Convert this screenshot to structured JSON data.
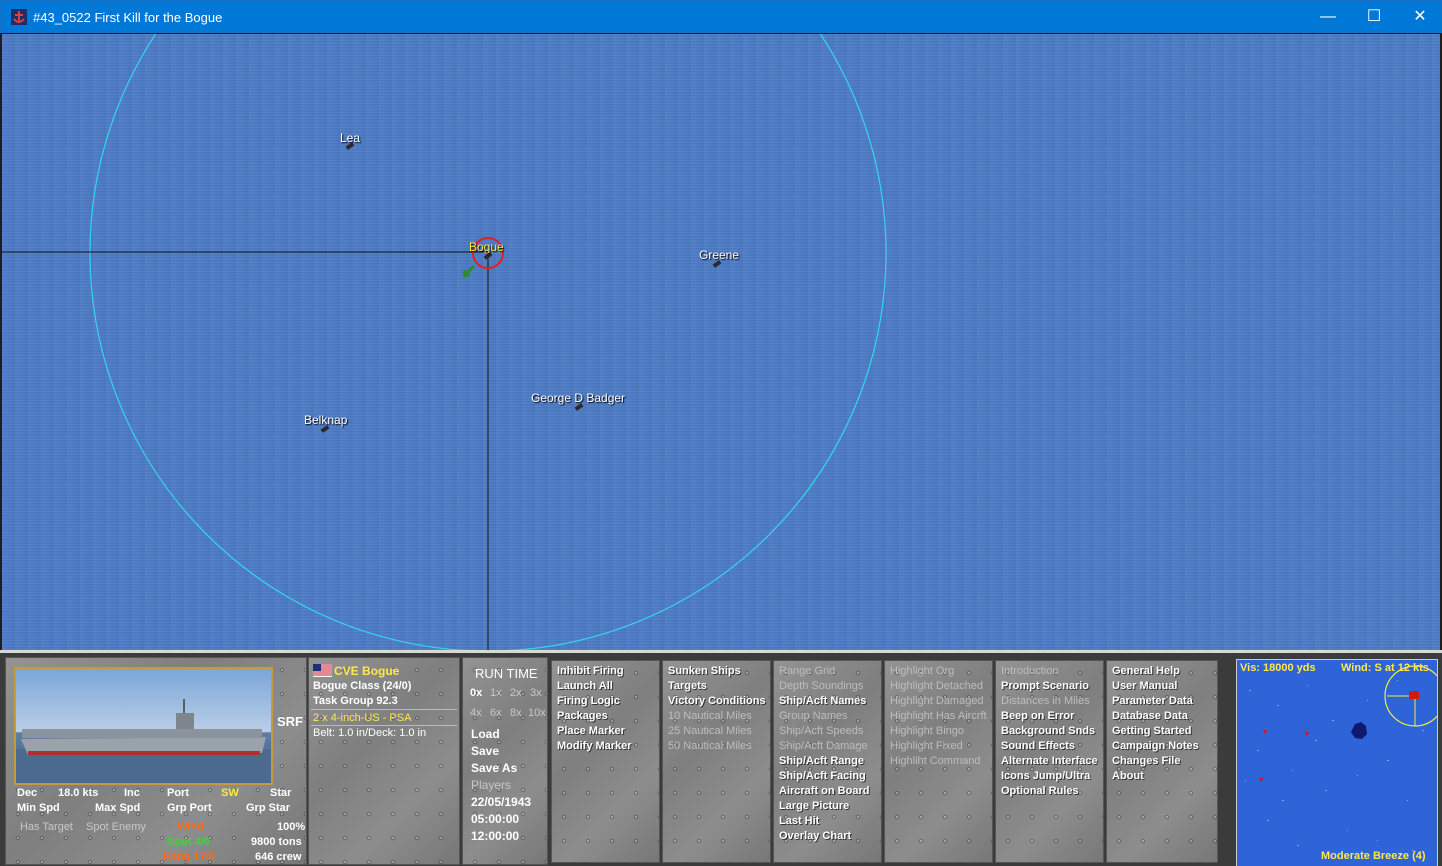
{
  "window": {
    "title": "#43_0522 First Kill for the Bogue",
    "minimize": "—",
    "maximize": "☐",
    "close": "✕"
  },
  "map": {
    "ships": [
      {
        "name": "Lea"
      },
      {
        "name": "Bogue",
        "selected": true
      },
      {
        "name": "Greene"
      },
      {
        "name": "George D Badger"
      },
      {
        "name": "Belknap"
      }
    ],
    "colors": {
      "sea": "#4a79c3",
      "range_circle": "#33d6f0",
      "selection": "#e02020"
    }
  },
  "unit": {
    "name": "CVE Bogue",
    "class": "Bogue Class (24/0)",
    "group": "Task Group 92.3",
    "weapon": "2 x 4-inch-US - PSA",
    "armor": "Belt: 1.0 in/Deck: 1.0 in",
    "srf": "SRF",
    "flag": "us-flag-icon"
  },
  "helm": {
    "dec": "Dec",
    "speed": "18.0 kts",
    "inc": "Inc",
    "port": "Port",
    "dir": "SW",
    "star": "Star",
    "min_spd": "Min Spd",
    "max_spd": "Max Spd",
    "grp_port": "Grp Port",
    "grp_star": "Grp Star"
  },
  "status": {
    "has_target": "Has Target",
    "spot_enemy": "Spot Enemy",
    "wind": "Wind",
    "percent": "100%",
    "spot": "Spot 4/0",
    "tons": "9800 tons",
    "hang": "Hang 17/0",
    "crew": "646 crew"
  },
  "time": {
    "title": "RUN TIME",
    "speeds_row1": [
      "0x",
      "1x",
      "2x",
      "3x"
    ],
    "speeds_row2": [
      "4x",
      "6x",
      "8x",
      "10x"
    ],
    "file": [
      "Load",
      "Save",
      "Save As"
    ],
    "players": "Players",
    "date": "22/05/1943",
    "time1": "05:00:00",
    "time2": "12:00:00"
  },
  "menus": {
    "col1": [
      {
        "label": "Inhibit Firing",
        "enabled": true
      },
      {
        "label": "Launch All",
        "enabled": true
      },
      {
        "label": "Firing Logic",
        "enabled": true
      },
      {
        "label": "Packages",
        "enabled": true
      },
      {
        "label": "Place Marker",
        "enabled": true
      },
      {
        "label": "Modify Marker",
        "enabled": true
      }
    ],
    "col2": [
      {
        "label": "Sunken Ships",
        "enabled": true
      },
      {
        "label": "Targets",
        "enabled": true
      },
      {
        "label": "Victory Conditions",
        "enabled": true
      },
      {
        "label": "10 Nautical Miles",
        "enabled": false
      },
      {
        "label": "25 Nautical Miles",
        "enabled": false
      },
      {
        "label": "50 Nautical Miles",
        "enabled": false
      }
    ],
    "col3": [
      {
        "label": "Range Grid",
        "enabled": false
      },
      {
        "label": "Depth Soundings",
        "enabled": false
      },
      {
        "label": "Ship/Acft Names",
        "enabled": true
      },
      {
        "label": "Group Names",
        "enabled": false
      },
      {
        "label": "Ship/Acft Speeds",
        "enabled": false
      },
      {
        "label": "Ship/Acft Damage",
        "enabled": false
      },
      {
        "label": "Ship/Acft Range",
        "enabled": true
      },
      {
        "label": "Ship/Acft Facing",
        "enabled": true
      },
      {
        "label": "Aircraft on Board",
        "enabled": true
      },
      {
        "label": "Large Picture",
        "enabled": true
      },
      {
        "label": "Last Hit",
        "enabled": true
      },
      {
        "label": "Overlay Chart",
        "enabled": true
      }
    ],
    "col4": [
      {
        "label": "Highlight Org",
        "enabled": false
      },
      {
        "label": "Highlight Detached",
        "enabled": false
      },
      {
        "label": "Highlight Damaged",
        "enabled": false
      },
      {
        "label": "Highlight Has Aircrft",
        "enabled": false
      },
      {
        "label": "Highlight Bingo",
        "enabled": false
      },
      {
        "label": "Highlight Fixed",
        "enabled": false
      },
      {
        "label": "Highliht Command",
        "enabled": false
      }
    ],
    "col5": [
      {
        "label": "Introduction",
        "enabled": false
      },
      {
        "label": "Prompt Scenario",
        "enabled": true
      },
      {
        "label": "Distances in Miles",
        "enabled": false
      },
      {
        "label": "Beep on Error",
        "enabled": true
      },
      {
        "label": "Background Snds",
        "enabled": true
      },
      {
        "label": "Sound Effects",
        "enabled": true
      },
      {
        "label": "Alternate Interface",
        "enabled": true
      },
      {
        "label": "Icons Jump/Ultra",
        "enabled": true
      },
      {
        "label": "Optional Rules",
        "enabled": true
      }
    ],
    "col6": [
      {
        "label": "General Help",
        "enabled": true
      },
      {
        "label": "User Manual",
        "enabled": true
      },
      {
        "label": "Parameter Data",
        "enabled": true
      },
      {
        "label": "Database Data",
        "enabled": true
      },
      {
        "label": "Getting Started",
        "enabled": true
      },
      {
        "label": "Campaign Notes",
        "enabled": true
      },
      {
        "label": "Changes File",
        "enabled": true
      },
      {
        "label": "About",
        "enabled": true
      }
    ]
  },
  "minimap": {
    "vis": "Vis: 18000 yds",
    "wind": "Wind: S at 12 kts",
    "sea_state": "Moderate Breeze (4)"
  }
}
